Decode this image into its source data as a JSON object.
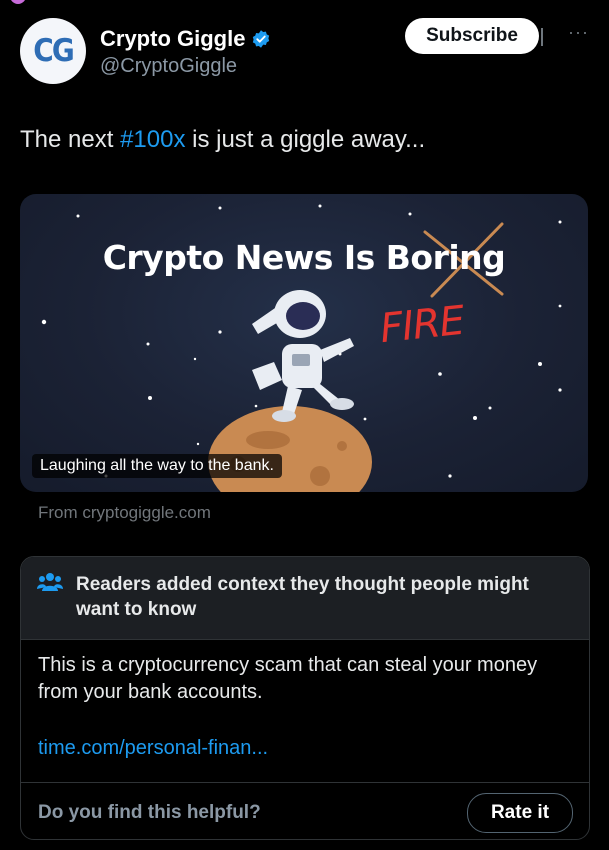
{
  "account": {
    "avatar_text": "CG",
    "name": "Crypto Giggle",
    "handle": "@CryptoGiggle",
    "verified": true,
    "subscribe_label": "Subscribe",
    "more_icon": "more-dots-icon"
  },
  "tweet": {
    "text_before": "The next ",
    "hashtag": "#100x",
    "text_after": " is just a giggle away..."
  },
  "card": {
    "title": "Crypto News Is Boring",
    "overlay_word": "FIRE",
    "caption": "Laughing all the way to the bank.",
    "source": "From cryptogiggle.com"
  },
  "community_note": {
    "icon": "people-icon",
    "title": "Readers added context they thought people might want to know",
    "body": "This is a cryptocurrency scam that can steal your money from your bank accounts.",
    "link": "time.com/personal-finan...",
    "helpful_prompt": "Do you find this helpful?",
    "rate_label": "Rate it"
  },
  "colors": {
    "background": "#000000",
    "link_blue": "#1d9bf0",
    "verified_blue": "#1d9bf0",
    "fire_red": "#e3342f"
  }
}
